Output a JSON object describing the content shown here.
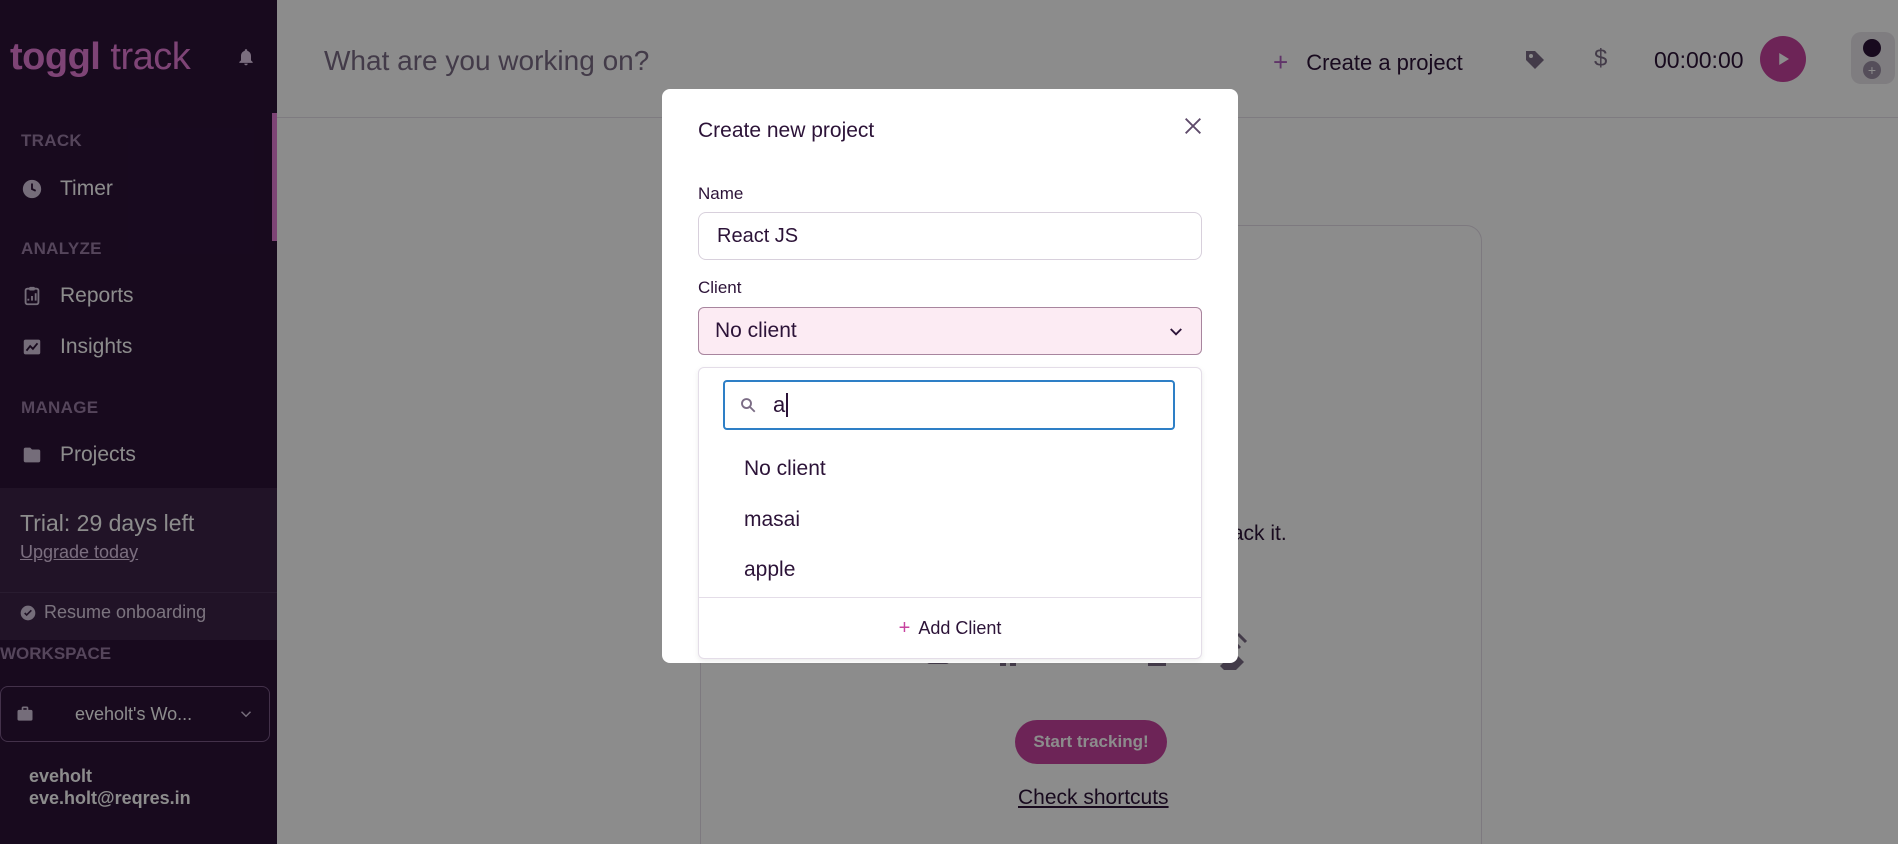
{
  "sidebar": {
    "logo_bold": "toggl",
    "logo_light": "track",
    "sections": {
      "track": "TRACK",
      "analyze": "ANALYZE",
      "manage": "MANAGE"
    },
    "items": {
      "timer": "Timer",
      "reports": "Reports",
      "insights": "Insights",
      "projects": "Projects"
    },
    "trial_text": "Trial: 29 days left",
    "upgrade_link": "Upgrade today",
    "resume_onboarding": "Resume onboarding",
    "workspace_label": "WORKSPACE",
    "workspace_name": "eveholt's Wo...",
    "user_name": "eveholt",
    "user_email": "eve.holt@reqres.in"
  },
  "header": {
    "placeholder": "What are you working on?",
    "create_project": "Create a project",
    "currency_symbol": "$",
    "timer": "00:00:00"
  },
  "card": {
    "text_fragment": "track it.",
    "start_button": "Start tracking!",
    "shortcuts_link": "Check shortcuts"
  },
  "modal": {
    "title": "Create new project",
    "name_label": "Name",
    "name_value": "React JS",
    "client_label": "Client",
    "client_selected": "No client",
    "search_value": "a",
    "options": [
      "No client",
      "masai",
      "apple"
    ],
    "add_client": "Add Client"
  },
  "colors": {
    "sidebar_bg": "#2c1338",
    "accent": "#c7439f",
    "logo": "#e57cd8",
    "focus_border": "#2e7fc6"
  }
}
